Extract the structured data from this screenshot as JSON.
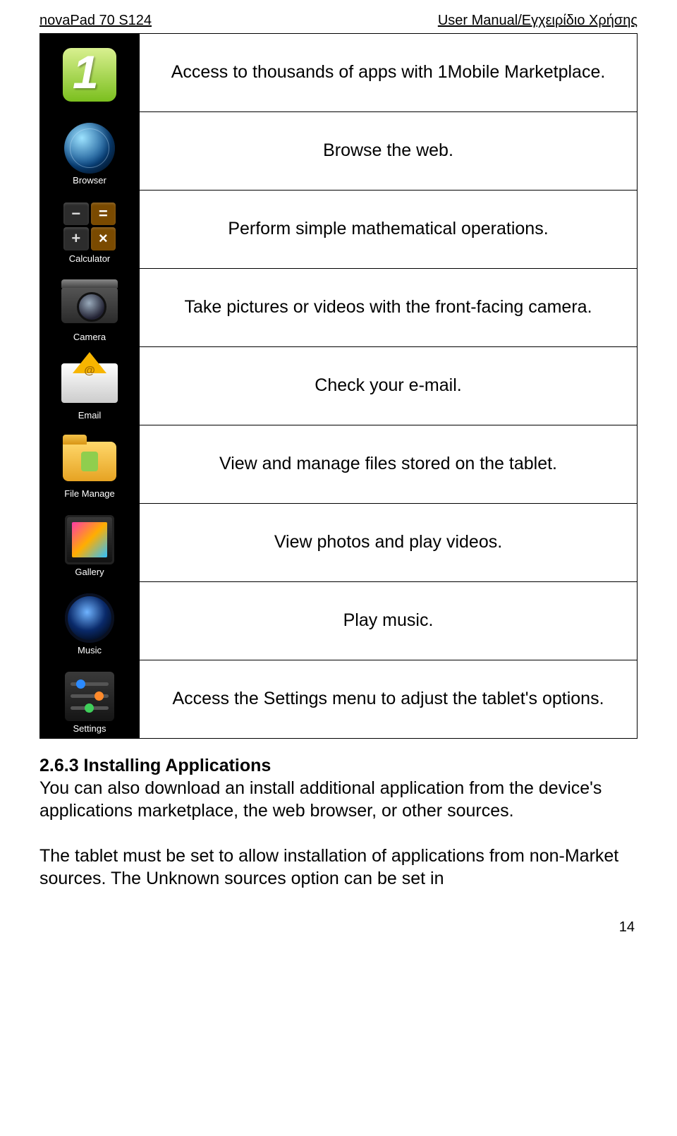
{
  "header": {
    "left": "novaPad 70 S124",
    "right": "User Manual/Εγχειρίδιο Χρήσης"
  },
  "rows": [
    {
      "label": "",
      "desc": "Access to thousands of apps with 1Mobile Marketplace."
    },
    {
      "label": "Browser",
      "desc": "Browse the web."
    },
    {
      "label": "Calculator",
      "desc": "Perform simple mathematical operations."
    },
    {
      "label": "Camera",
      "desc": "Take pictures or videos with the front-facing camera."
    },
    {
      "label": "Email",
      "desc": "Check your e-mail."
    },
    {
      "label": "File Manage",
      "desc": "View and manage files stored on the tablet."
    },
    {
      "label": "Gallery",
      "desc": "View photos and play videos."
    },
    {
      "label": "Music",
      "desc": "Play music."
    },
    {
      "label": "Settings",
      "desc": "Access the Settings menu to adjust the tablet's options."
    }
  ],
  "section": {
    "title": "2.6.3 Installing Applications",
    "p1": "You can also download an install additional application from the device's applications marketplace, the web browser, or other sources.",
    "p2": "The tablet must be set to allow installation of applications from non-Market sources. The Unknown sources option can be set in"
  },
  "page_number": "14"
}
